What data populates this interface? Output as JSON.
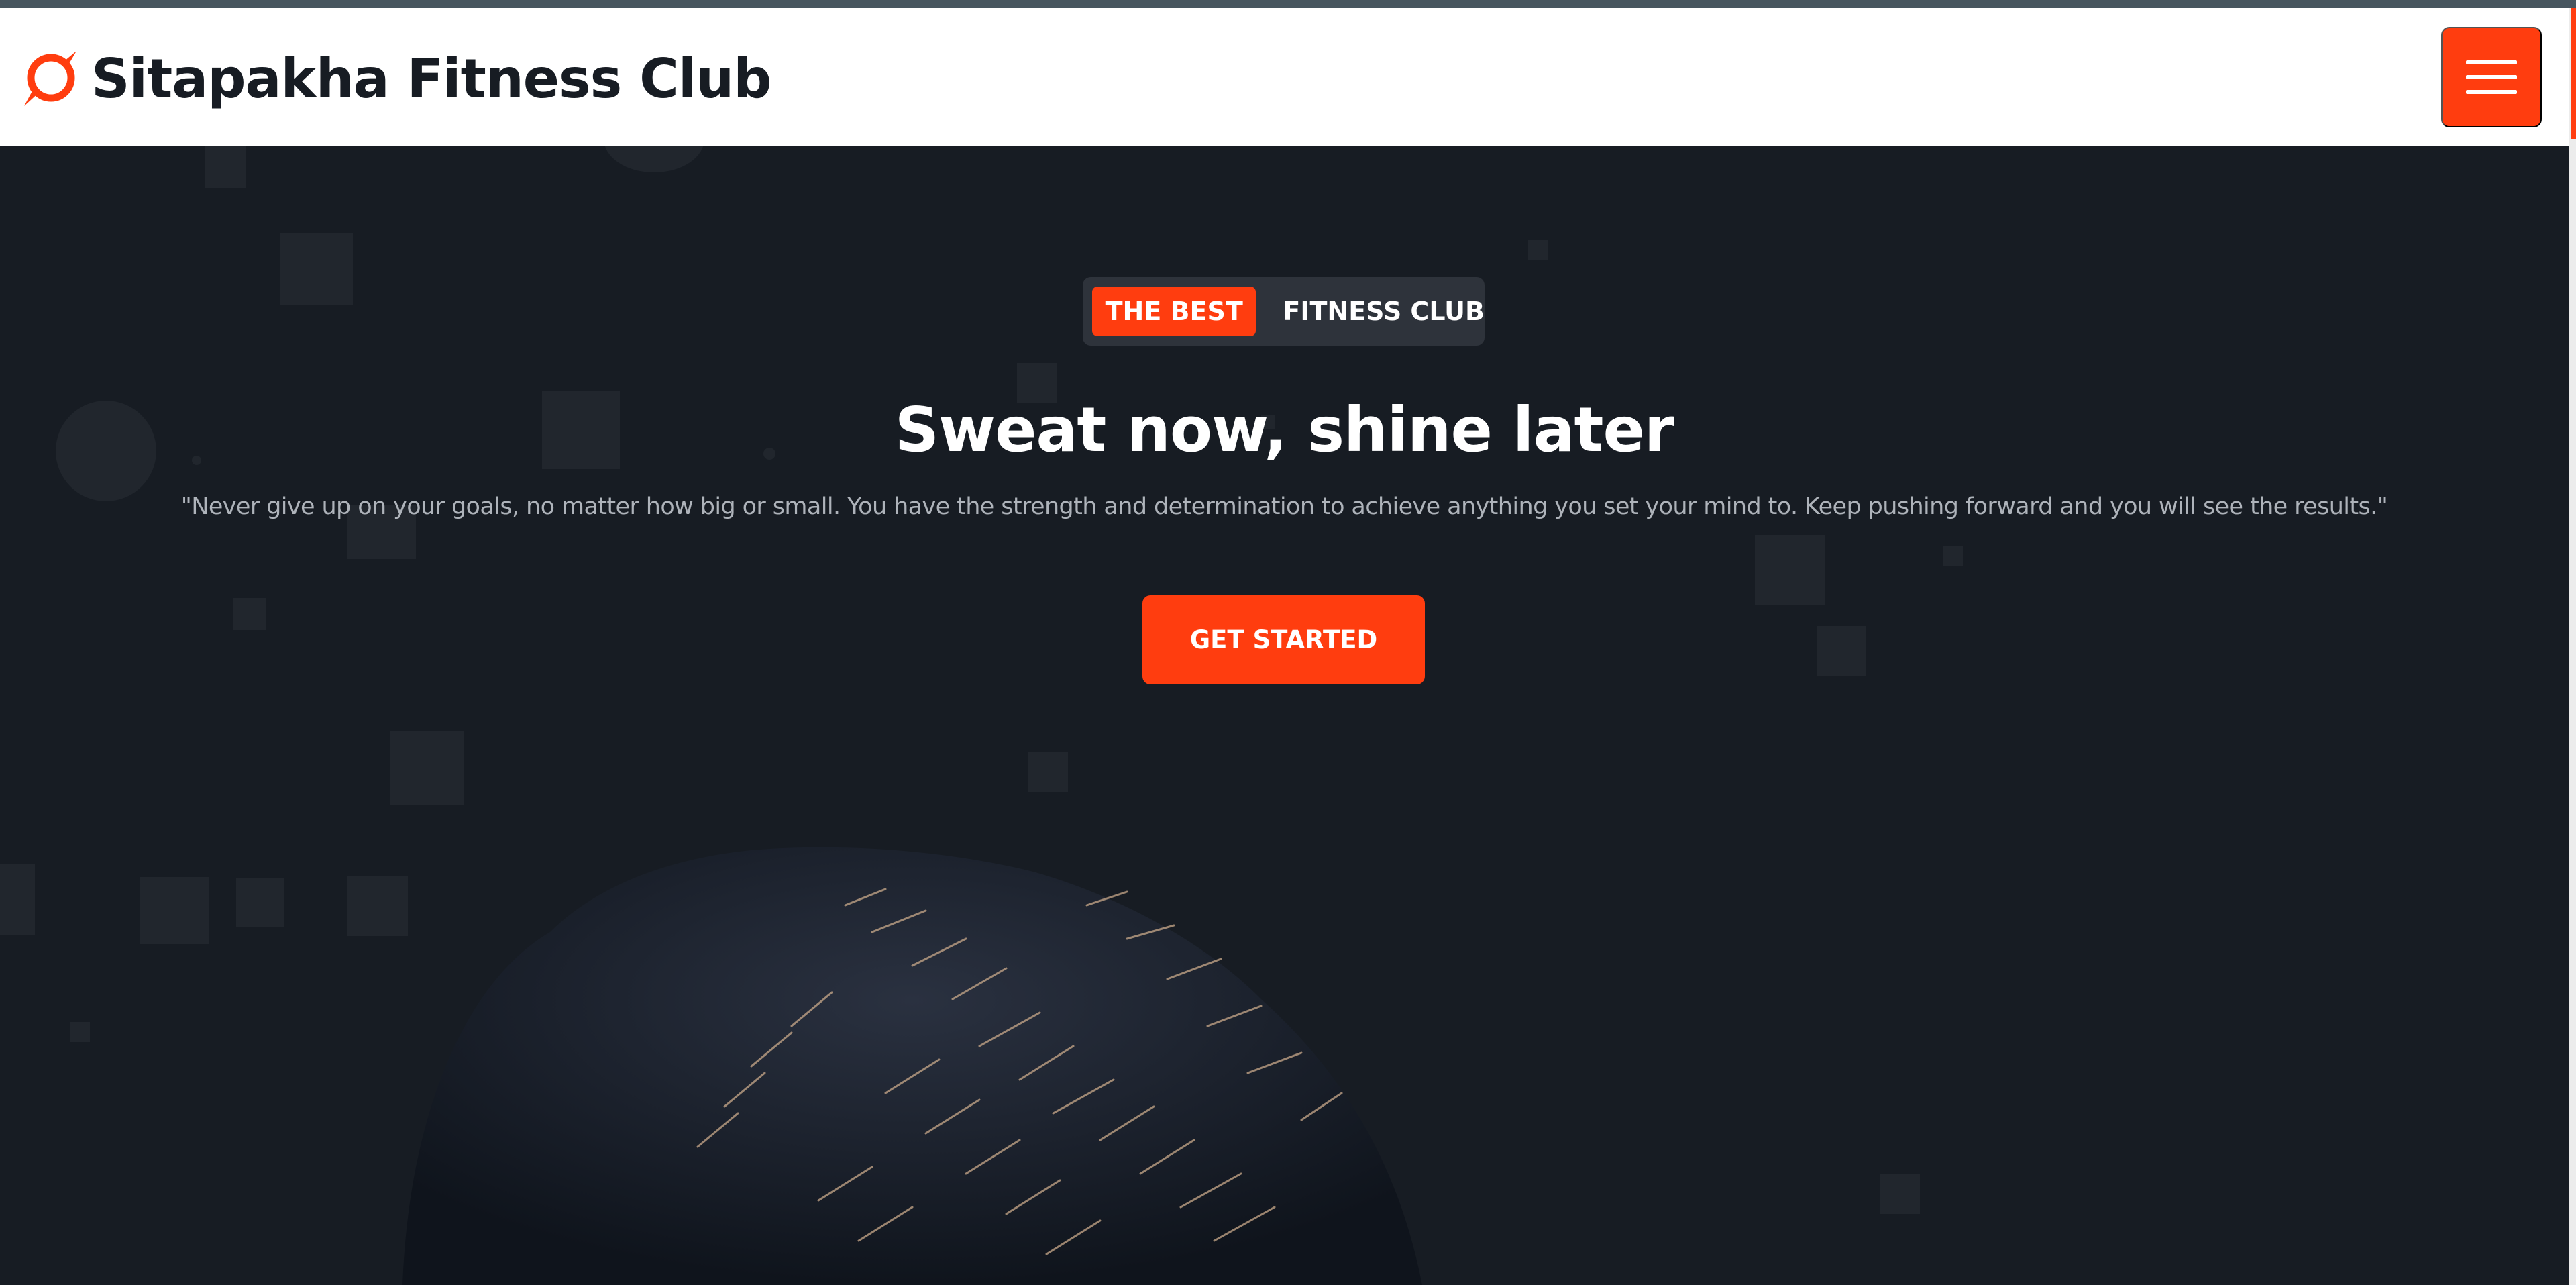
{
  "navbar": {
    "brand_name": "Sitapakha Fitness Club",
    "logo_icon": "brand-swirl-icon",
    "menu_icon": "hamburger-menu-icon"
  },
  "hero": {
    "badge_accent": "THE BEST",
    "badge_text": "FITNESS CLUB",
    "title": "Sweat now, shine later",
    "quote": "\"Never give up on your goals, no matter how big or small. You have the strength and determination to achieve anything you set your mind to. Keep pushing forward and you will see the results.\"",
    "cta_label": "GET STARTED"
  },
  "colors": {
    "accent": "#ff3d0f",
    "background_dark": "#171c23",
    "navbar_bg": "#ffffff",
    "text_light": "#ffffff",
    "text_muted": "#aeb3ba"
  }
}
